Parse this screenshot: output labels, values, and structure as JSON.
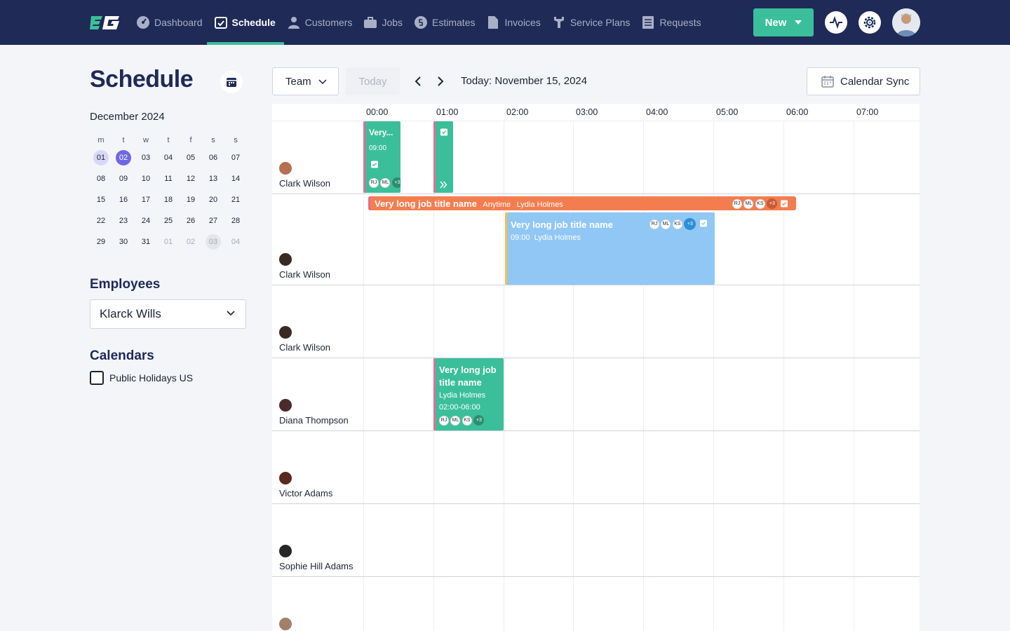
{
  "nav": {
    "items": [
      {
        "label": "Dashboard",
        "icon": "gauge-icon"
      },
      {
        "label": "Schedule",
        "icon": "calendar-check-icon",
        "active": true
      },
      {
        "label": "Customers",
        "icon": "user-icon"
      },
      {
        "label": "Jobs",
        "icon": "briefcase-icon"
      },
      {
        "label": "Estimates",
        "icon": "dollar-icon"
      },
      {
        "label": "Invoices",
        "icon": "document-icon"
      },
      {
        "label": "Service Plans",
        "icon": "wrench-icon"
      },
      {
        "label": "Requests",
        "icon": "list-icon"
      }
    ],
    "new_label": "New"
  },
  "colors": {
    "nav_bg": "#1f2a57",
    "accent": "#3bbf9a",
    "orange": "#f47d4f",
    "blue": "#90c7f5",
    "purple": "#6f67e4"
  },
  "page_title": "Schedule",
  "mini_calendar": {
    "month": "December 2024",
    "weekdays": [
      "m",
      "t",
      "w",
      "t",
      "f",
      "s",
      "s"
    ],
    "weeks": [
      [
        "01",
        "02",
        "03",
        "04",
        "05",
        "06",
        "07"
      ],
      [
        "08",
        "09",
        "10",
        "11",
        "12",
        "13",
        "14"
      ],
      [
        "15",
        "16",
        "17",
        "18",
        "19",
        "20",
        "21"
      ],
      [
        "22",
        "23",
        "24",
        "25",
        "26",
        "27",
        "28"
      ],
      [
        "29",
        "30",
        "31",
        "01",
        "02",
        "03",
        "04"
      ]
    ]
  },
  "employees_section": {
    "title": "Employees",
    "selected": "Klarck Wills"
  },
  "calendars_section": {
    "title": "Calendars",
    "items": [
      {
        "label": "Public Holidays US",
        "checked": false
      }
    ]
  },
  "toolbar": {
    "team_label": "Team",
    "today_label": "Today",
    "date_label": "Today: November 15, 2024",
    "sync_label": "Calendar Sync"
  },
  "timeline": {
    "hours": [
      "00:00",
      "01:00",
      "02:00",
      "03:00",
      "04:00",
      "05:00",
      "06:00",
      "07:00"
    ]
  },
  "rows": [
    {
      "name": "Clark Wilson"
    },
    {
      "name": "Clark Wilson"
    },
    {
      "name": "Clark Wilson"
    },
    {
      "name": "Diana Thompson"
    },
    {
      "name": "Victor Adams"
    },
    {
      "name": "Sophie Hill Adams"
    },
    {
      "name": ""
    }
  ],
  "events": {
    "e1": {
      "title": "Very...",
      "time": "09:00",
      "avatars": [
        "RJ",
        "ML"
      ],
      "more": "+3"
    },
    "e2": {
      "icon": "clipboard-check-icon"
    },
    "e3": {
      "title": "Very long job title name",
      "when": "Anytime",
      "assignee": "Lydia Holmes",
      "avatars": [
        "RJ",
        "ML",
        "KS"
      ],
      "more": "+3"
    },
    "e4": {
      "title": "Very long job title name",
      "time": "09:00",
      "assignee": "Lydia Holmes",
      "avatars": [
        "RJ",
        "ML",
        "KS"
      ],
      "more": "+3"
    },
    "e5": {
      "title": "Very long job title name",
      "assignee": "Lydia Holmes",
      "time": "02:00-06:00",
      "avatars": [
        "RJ",
        "ML",
        "KS"
      ],
      "more": "+3"
    }
  }
}
